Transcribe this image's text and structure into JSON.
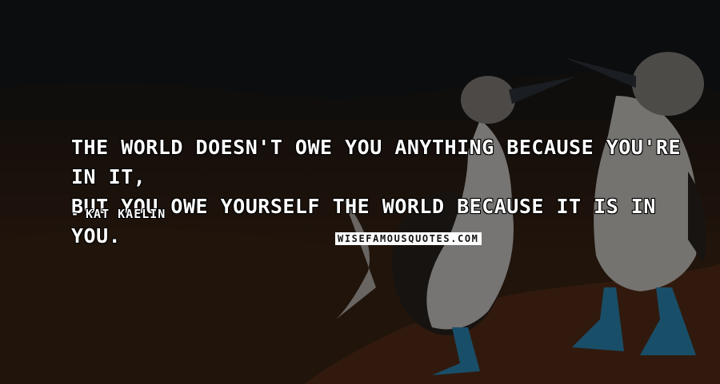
{
  "quote": {
    "line1": "The world doesn't owe you anything because you're in it,",
    "line2": "but you owe yourself the world because it is in you."
  },
  "author": {
    "dash": "-",
    "name": "Kat Kaelin"
  },
  "watermark": "wisefamousquotes.com",
  "photo": {
    "subject": "blue-footed booby birds",
    "colors": {
      "sky": "#15171a",
      "ground": "#4a2c18",
      "feet": "#2f8fc0",
      "bird_body": "#d8d6d2"
    }
  }
}
